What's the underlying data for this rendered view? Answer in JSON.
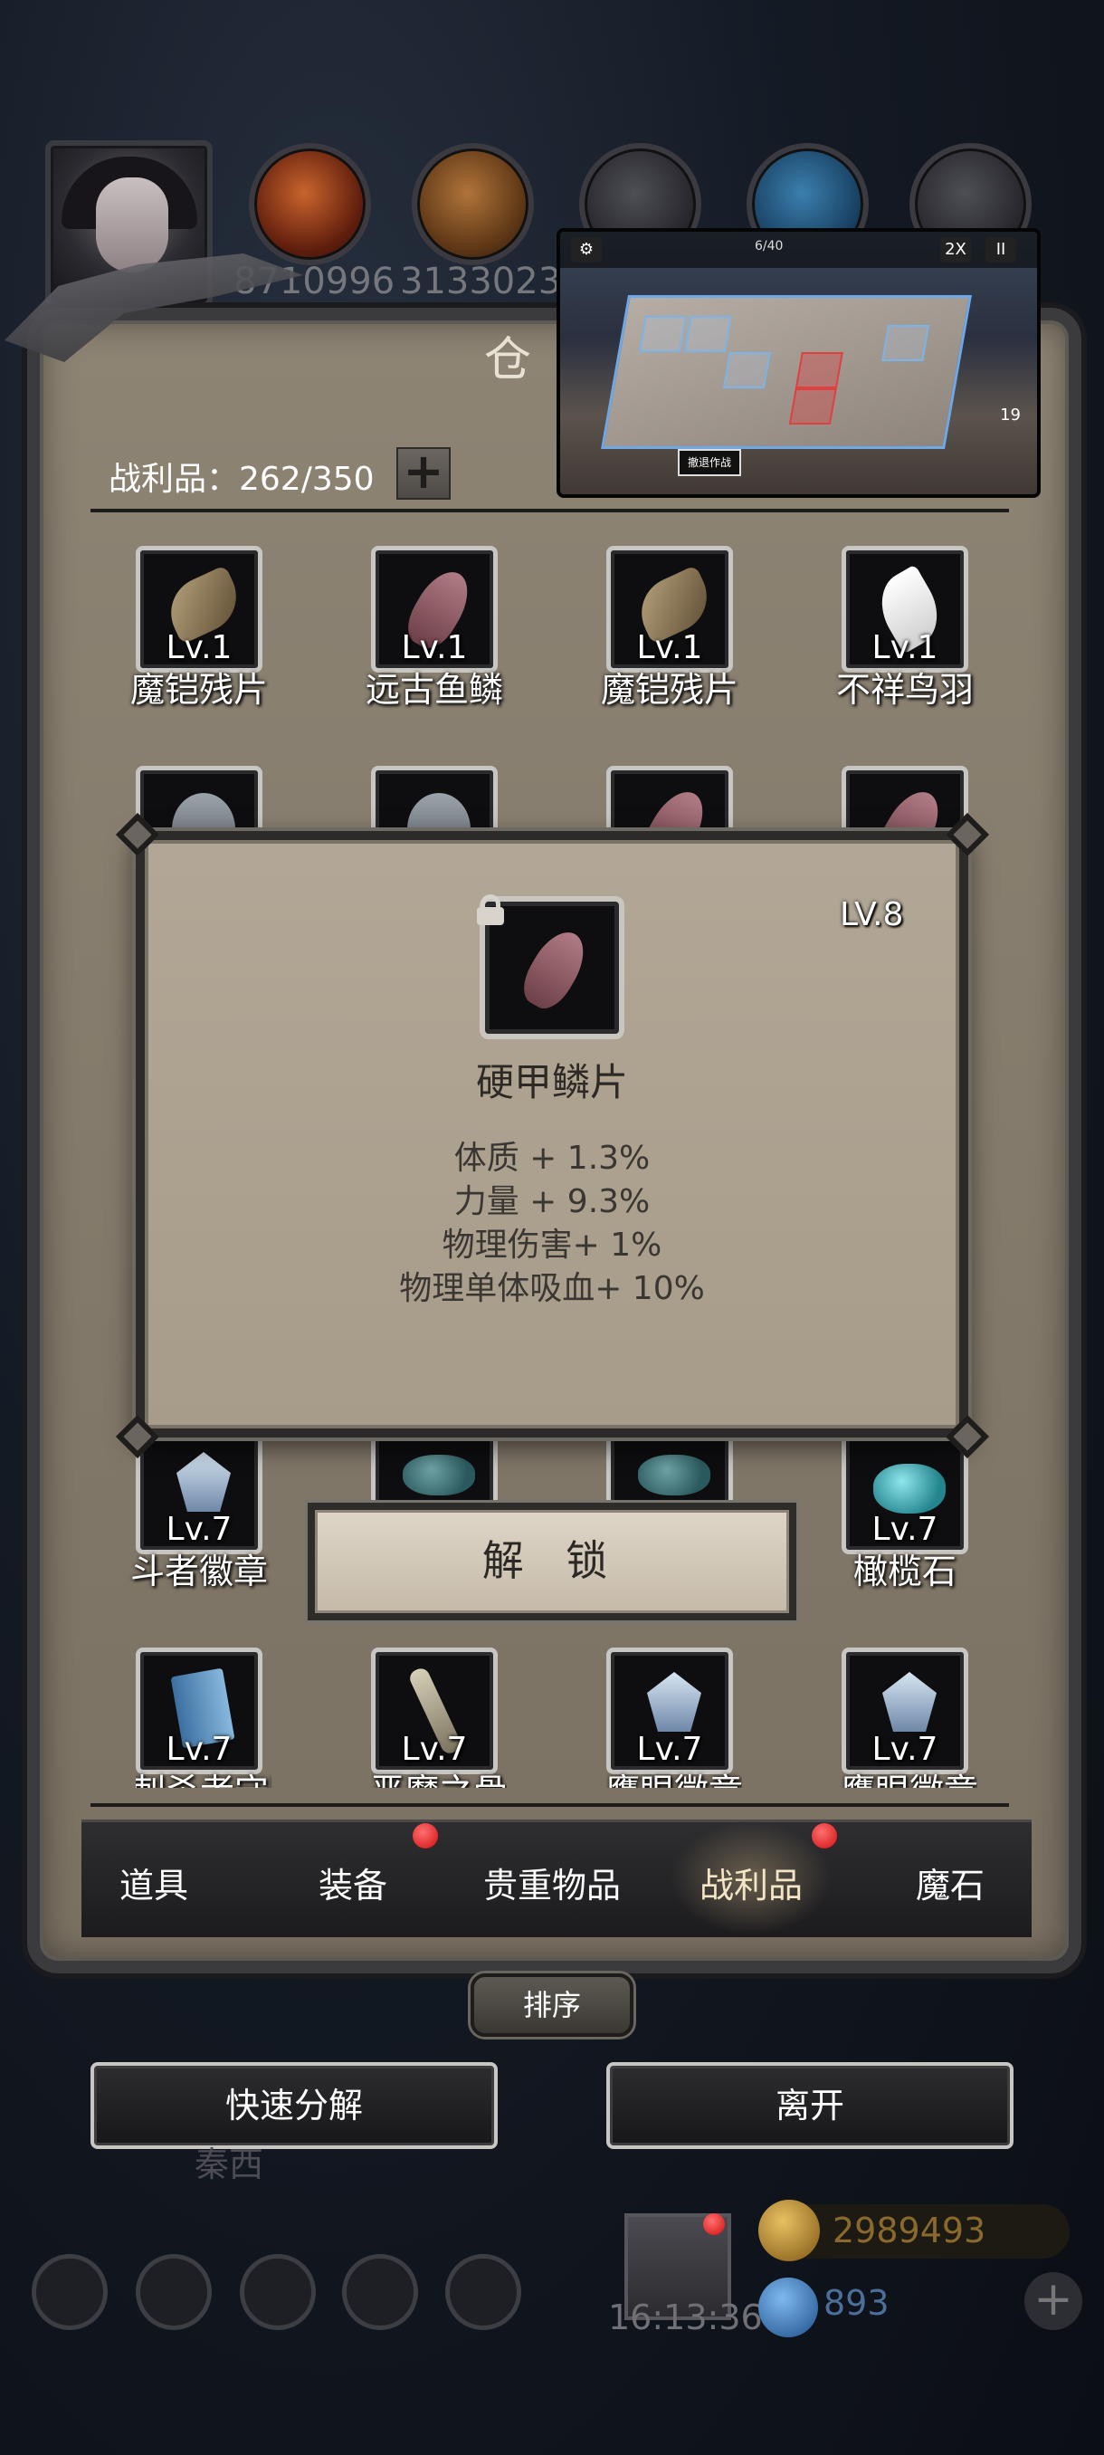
{
  "hud": {
    "resource_1": "8710996",
    "resource_2": "3133023",
    "gold": "2989493",
    "gems": "893",
    "clock": "16:13:36",
    "faded_label": "秦西"
  },
  "minimap": {
    "speed_label": "2X",
    "pause_label": "II",
    "cost": "6/40",
    "life": "19",
    "deploy_label": "撤退作战"
  },
  "panel": {
    "title_fragment": "仓",
    "count_label": "战利品：262/350",
    "plus_label": "+"
  },
  "grid_row1": [
    {
      "lv": "Lv.1",
      "name": "魔铠残片",
      "icon": "claw-icon"
    },
    {
      "lv": "Lv.1",
      "name": "远古鱼鳞",
      "icon": "scale-icon"
    },
    {
      "lv": "Lv.1",
      "name": "魔铠残片",
      "icon": "claw-icon"
    },
    {
      "lv": "Lv.1",
      "name": "不祥鸟羽",
      "icon": "feather-icon"
    }
  ],
  "grid_row4": [
    {
      "lv": "Lv.7",
      "name": "斗者徽章",
      "icon": "badge-icon"
    },
    {
      "lv": "Lv.7",
      "name": "橄榄石",
      "icon": "stone-icon"
    }
  ],
  "grid_row5": [
    {
      "lv": "Lv.7",
      "name": "刺杀者守则",
      "icon": "book-icon"
    },
    {
      "lv": "Lv.7",
      "name": "恶魔之骨",
      "icon": "bone-icon"
    },
    {
      "lv": "Lv.7",
      "name": "鹰眼徽章",
      "icon": "badge-icon"
    },
    {
      "lv": "Lv.7",
      "name": "鹰眼徽章",
      "icon": "badge-icon"
    }
  ],
  "modal": {
    "level": "LV.8",
    "item_name": "硬甲鳞片",
    "attributes": [
      "体质 + 1.3%",
      "力量 + 9.3%",
      "物理伤害+ 1%",
      "物理单体吸血+ 10%"
    ],
    "unlock_label": "解 锁"
  },
  "tabs": [
    "道具",
    "装备",
    "贵重物品",
    "战利品",
    "魔石"
  ],
  "active_tab": "战利品",
  "sort_label": "排序",
  "actions": {
    "quick_decompose": "快速分解",
    "leave": "离开"
  },
  "colors": {
    "panel_bg": "#8e8474",
    "modal_bg": "#b2a796",
    "notification_dot": "#d10d0d"
  }
}
